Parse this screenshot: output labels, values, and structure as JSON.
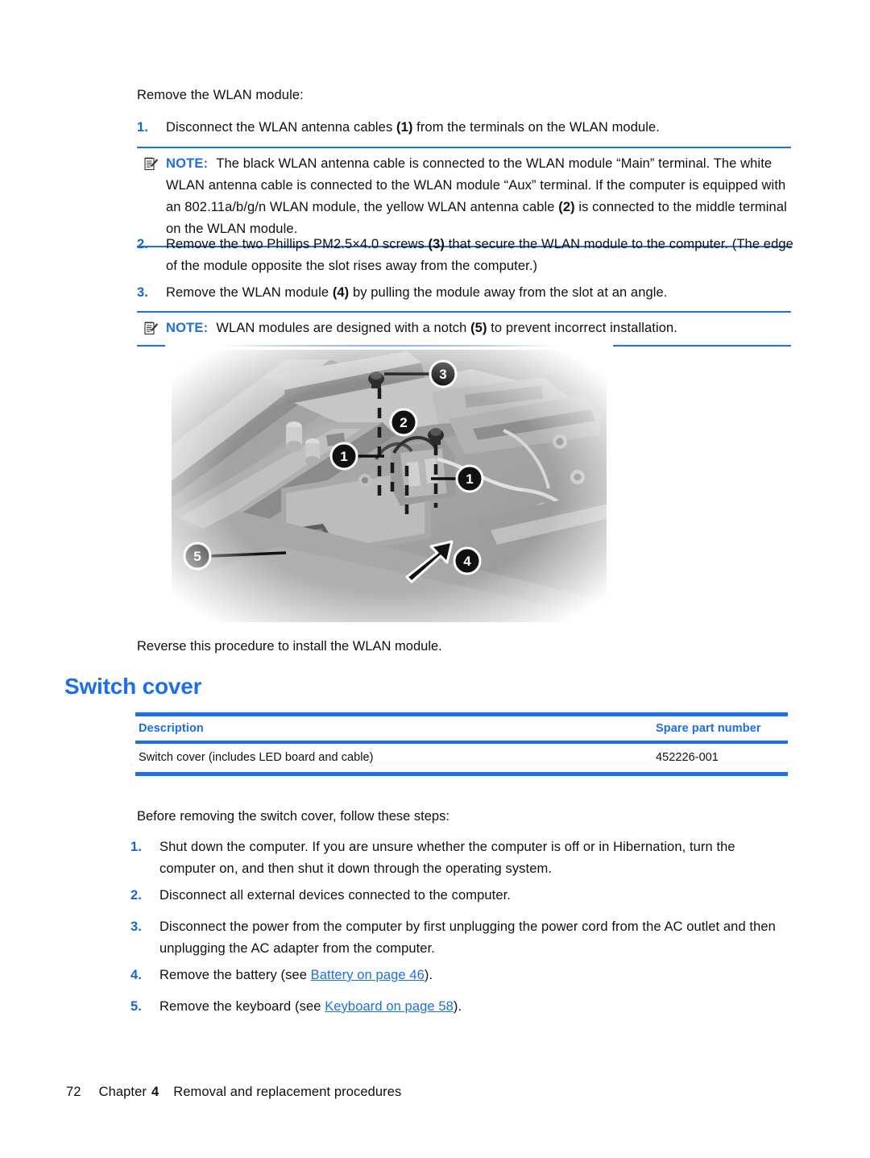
{
  "document": {
    "intro_line": "Remove the WLAN module:",
    "reverse_line": "Reverse this procedure to install the WLAN module."
  },
  "colors": {
    "accent_blue": "#1a6ef5",
    "text_black": "#101010",
    "link_blue": "#1a6ef5"
  },
  "wlan_steps": [
    {
      "number": "1.",
      "text_a": "Disconnect the WLAN antenna cables ",
      "cue": "(1)",
      "text_b": " from the terminals on the WLAN module."
    },
    {
      "number": "2.",
      "text_a": "Remove the two Phillips PM2.5×4.0 screws ",
      "cue": "(3)",
      "text_b": " that secure the WLAN module to the computer. (The edge of the module opposite the slot rises away from the computer.)"
    },
    {
      "number": "3.",
      "text_a": "Remove the WLAN module ",
      "cue": "(4)",
      "text_b": " by pulling the module away from the slot at an angle."
    }
  ],
  "notes": [
    {
      "icon": "note-pad-pencil-icon",
      "label": "NOTE:",
      "text_a": "The black WLAN antenna cable is connected to the WLAN module “Main” terminal. The white WLAN antenna cable is connected to the WLAN module “Aux” terminal. If the computer is equipped with an 802.11a/b/g/n WLAN module, the yellow WLAN antenna cable ",
      "cue": "(2)",
      "text_b": " is connected to the middle terminal on the WLAN module."
    },
    {
      "icon": "note-pad-pencil-icon",
      "label": "NOTE:",
      "text_a": "WLAN modules are designed with a notch ",
      "cue": "(5)",
      "text_b": " to prevent incorrect installation."
    }
  ],
  "figure": {
    "name": "wlan-module-removal-photo",
    "alt": "Grayscale photo of laptop base showing WLAN module bay with callouts",
    "callouts": [
      {
        "label": "3",
        "meaning": "Phillips PM2.5x4.0 screws"
      },
      {
        "label": "2",
        "meaning": "Yellow WLAN antenna cable (middle terminal)"
      },
      {
        "label": "1",
        "meaning": "WLAN antenna cables (left)"
      },
      {
        "label": "1",
        "meaning": "WLAN antenna cables (right)"
      },
      {
        "label": "4",
        "meaning": "Pull module away from slot at an angle"
      },
      {
        "label": "5",
        "meaning": "Notch to prevent incorrect installation"
      }
    ]
  },
  "section": {
    "heading": "Switch cover"
  },
  "parts_table": {
    "headers": [
      "Description",
      "Spare part number"
    ],
    "rows": [
      [
        "Switch cover (includes LED board and cable)",
        "452226-001"
      ]
    ]
  },
  "switch_cover_intro": "Before removing the switch cover, follow these steps:",
  "switch_cover_steps": [
    {
      "number": "1.",
      "text": "Shut down the computer. If you are unsure whether the computer is off or in Hibernation, turn the computer on, and then shut it down through the operating system."
    },
    {
      "number": "2.",
      "text": "Disconnect all external devices connected to the computer."
    },
    {
      "number": "3.",
      "text": "Disconnect the power from the computer by first unplugging the power cord from the AC outlet and then unplugging the AC adapter from the computer."
    },
    {
      "number": "4.",
      "text_a": "Remove the battery (see ",
      "link": "Battery on page 46",
      "text_b": ")."
    },
    {
      "number": "5.",
      "text_a": "Remove the keyboard (see ",
      "link": "Keyboard on page 58",
      "text_b": ")."
    }
  ],
  "footer": {
    "page_number": "72",
    "chapter_label": "Chapter",
    "chapter_number": "4",
    "chapter_title": "Removal and replacement procedures"
  }
}
